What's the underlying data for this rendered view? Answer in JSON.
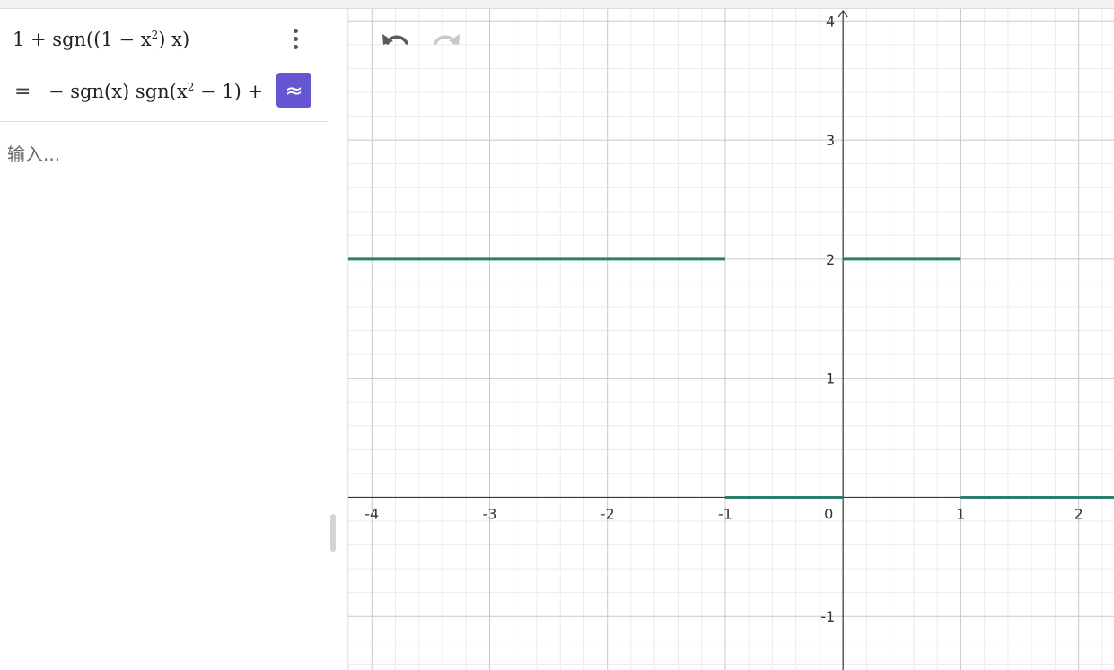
{
  "algebra": {
    "expression": {
      "p1": "1 + sgn((1 − x",
      "sup": "2",
      "p2": ") x)"
    },
    "result": {
      "eq": "=",
      "p1": "− sgn(x)  sgn(x",
      "sup": "2",
      "p2": " − 1) +"
    },
    "approx_button": "≈",
    "input_placeholder": "输入..."
  },
  "toolbar": {
    "undo_icon": "undo-icon",
    "redo_icon": "redo-icon"
  },
  "colors": {
    "accent": "#6557d2",
    "curve": "#2e7d6f",
    "grid_major": "#c8c8c8",
    "grid_minor": "#ebebeb",
    "axis": "#333333"
  },
  "chart_data": {
    "type": "line",
    "function": "1 + sgn((1 − x^2) x)",
    "xlim": [
      -4.2,
      2.3
    ],
    "ylim": [
      -1.45,
      4.1
    ],
    "x_ticks": [
      "-4",
      "-3",
      "-2",
      "-1",
      "0",
      "1",
      "2"
    ],
    "y_ticks": [
      "-1",
      "1",
      "2",
      "3",
      "4"
    ],
    "grid": true,
    "series": [
      {
        "segments": [
          {
            "x": [
              -4.2,
              -1
            ],
            "y": [
              2,
              2
            ]
          },
          {
            "x": [
              -1,
              0
            ],
            "y": [
              0,
              0
            ]
          },
          {
            "x": [
              0,
              1
            ],
            "y": [
              2,
              2
            ]
          },
          {
            "x": [
              1,
              2.3
            ],
            "y": [
              0,
              0
            ]
          }
        ]
      }
    ]
  }
}
